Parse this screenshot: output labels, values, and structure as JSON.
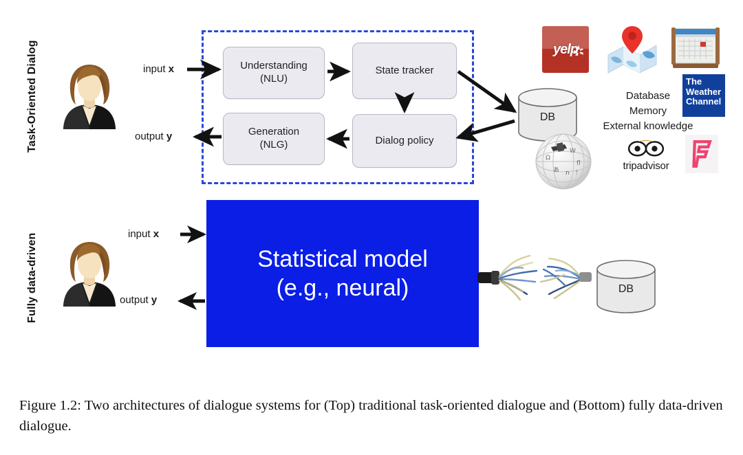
{
  "figure": {
    "caption": "Figure 1.2: Two architectures of dialogue systems for (Top) traditional task-oriented dialogue and (Bottom) fully data-driven dialogue."
  },
  "colors": {
    "dashed_border": "#2a47d6",
    "statistical_model_box": "#0a1ee6",
    "module_fill": "#eceaf1",
    "yelp_red": "#b33225",
    "weather_channel_blue": "#11409c",
    "foursquare_pink": "#f0436f",
    "map_pin_red": "#e8322a"
  },
  "top_section": {
    "side_label": "Task-Oriented Dialog",
    "avatar": "user-avatar",
    "input_label_prefix": "input ",
    "input_label_var": "x",
    "output_label_prefix": "output ",
    "output_label_var": "y",
    "modules": [
      {
        "name": "nlu",
        "line1": "Understanding",
        "line2": "(NLU)"
      },
      {
        "name": "state-tracker",
        "line1": "State tracker",
        "line2": ""
      },
      {
        "name": "dialog-policy",
        "line1": "Dialog policy",
        "line2": ""
      },
      {
        "name": "nlg",
        "line1": "Generation",
        "line2": "(NLG)"
      }
    ],
    "db_label": "DB",
    "knowledge_lines": [
      "Database",
      "Memory",
      "External knowledge"
    ],
    "logos": [
      {
        "name": "yelp-logo",
        "text": "yelp"
      },
      {
        "name": "maps-logo",
        "text": ""
      },
      {
        "name": "calendar-logo",
        "text": ""
      },
      {
        "name": "weather-channel-logo",
        "line1": "The",
        "line2": "Weather",
        "line3": "Channel"
      },
      {
        "name": "wikipedia-globe-logo",
        "text": ""
      },
      {
        "name": "tripadvisor-logo",
        "text": "tripadvisor"
      },
      {
        "name": "foursquare-logo",
        "text": "F"
      }
    ]
  },
  "bottom_section": {
    "side_label": "Fully data-driven",
    "avatar": "user-avatar",
    "input_label_prefix": "input ",
    "input_label_var": "x",
    "output_label_prefix": "output ",
    "output_label_var": "y",
    "model_line1": "Statistical model",
    "model_line2": "(e.g., neural)",
    "db_label": "DB",
    "cable": "frayed-network-cable"
  }
}
